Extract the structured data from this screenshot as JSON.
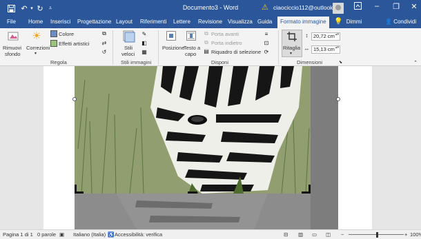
{
  "window": {
    "title": "Documento3 - Word",
    "account": "ciaociccio112@outlook.it"
  },
  "tabs": [
    {
      "label": "File"
    },
    {
      "label": "Home"
    },
    {
      "label": "Inserisci"
    },
    {
      "label": "Progettazione"
    },
    {
      "label": "Layout"
    },
    {
      "label": "Riferimenti"
    },
    {
      "label": "Lettere"
    },
    {
      "label": "Revisione"
    },
    {
      "label": "Visualizza"
    },
    {
      "label": "Guida"
    },
    {
      "label": "Formato immagine",
      "active": true
    }
  ],
  "tell_me": "Dimmi",
  "share": "Condividi",
  "ribbon": {
    "regola": {
      "group_label": "Regola",
      "rimuovi_line1": "Rimuovi",
      "rimuovi_line2": "sfondo",
      "correzioni": "Correzioni",
      "colore": "Colore",
      "effetti": "Effetti artistici"
    },
    "stili": {
      "group_label": "Stili immagini",
      "stili_line1": "Stili",
      "stili_line2": "veloci"
    },
    "disponi": {
      "group_label": "Disponi",
      "posizione": "Posizione",
      "testo_line1": "Testo a",
      "testo_line2": "capo",
      "porta_avanti": "Porta avanti",
      "porta_indietro": "Porta indietro",
      "riquadro": "Riquadro di selezione"
    },
    "dimensioni": {
      "group_label": "Dimensioni",
      "ritaglia": "Ritaglia",
      "height_value": "20,72 cm",
      "width_value": "15,13 cm"
    }
  },
  "status": {
    "page": "Pagina 1 di 1",
    "words": "0 parole",
    "language": "Italiano (Italia)",
    "accessibility": "Accessibilità: verifica",
    "zoom": "100%",
    "zoom_minus": "−",
    "zoom_plus": "+"
  },
  "icons": {
    "save": "save-icon",
    "undo": "undo-icon",
    "redo": "redo-icon",
    "warning": "warning-icon",
    "lightbulb": "lightbulb-icon",
    "share": "person-share-icon"
  },
  "colors": {
    "accent": "#2b579a",
    "ribbon_bg": "#f3f3f3",
    "doc_bg": "#e6e6e6"
  }
}
